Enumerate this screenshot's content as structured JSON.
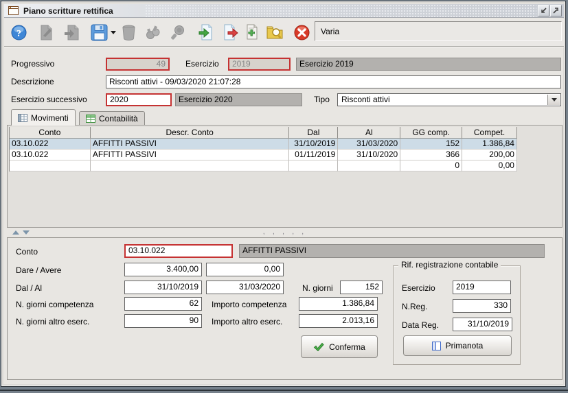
{
  "window": {
    "title": "Piano scritture rettifica"
  },
  "toolbar": {
    "status_text": "Varia",
    "icons": [
      {
        "name": "help",
        "enabled": true
      },
      {
        "name": "modify",
        "enabled": false
      },
      {
        "name": "duplicate",
        "enabled": false
      },
      {
        "name": "save",
        "enabled": true
      },
      {
        "name": "delete",
        "enabled": false
      },
      {
        "name": "keys",
        "enabled": false
      },
      {
        "name": "search",
        "enabled": false
      },
      {
        "name": "import",
        "enabled": true
      },
      {
        "name": "export",
        "enabled": true
      },
      {
        "name": "add-document",
        "enabled": true
      },
      {
        "name": "browse-archive",
        "enabled": true
      },
      {
        "name": "close",
        "enabled": true
      }
    ]
  },
  "form": {
    "progressivo": {
      "label": "Progressivo",
      "value": "49"
    },
    "esercizio": {
      "label": "Esercizio",
      "value": "2019",
      "display": "Esercizio 2019"
    },
    "descrizione": {
      "label": "Descrizione",
      "value": "Risconti attivi - 09/03/2020 21:07:28"
    },
    "esercizio_successivo": {
      "label": "Esercizio successivo",
      "value": "2020",
      "display": "Esercizio 2020"
    },
    "tipo": {
      "label": "Tipo",
      "value": "Risconti attivi"
    }
  },
  "tabs": {
    "movimenti": "Movimenti",
    "contabilita": "Contabilità"
  },
  "table": {
    "columns": [
      "Conto",
      "Descr. Conto",
      "Dal",
      "Al",
      "GG comp.",
      "Compet."
    ],
    "rows": [
      [
        "03.10.022",
        "AFFITTI PASSIVI",
        "31/10/2019",
        "31/03/2020",
        "152",
        "1.386,84"
      ],
      [
        "03.10.022",
        "AFFITTI PASSIVI",
        "01/11/2019",
        "31/10/2020",
        "366",
        "200,00"
      ],
      [
        "",
        "",
        "",
        "",
        "0",
        "0,00"
      ]
    ],
    "selected_row_index": 0
  },
  "detail": {
    "conto": {
      "label": "Conto",
      "value": "03.10.022",
      "descr": "AFFITTI PASSIVI"
    },
    "dare_avere": {
      "label": "Dare / Avere",
      "dare": "3.400,00",
      "avere": "0,00"
    },
    "dal_al": {
      "label": "Dal / Al",
      "dal": "31/10/2019",
      "al": "31/03/2020"
    },
    "n_giorni": {
      "label": "N. giorni",
      "value": "152"
    },
    "giorni_competenza": {
      "label": "N. giorni competenza",
      "value": "62"
    },
    "importo_competenza": {
      "label": "Importo competenza",
      "value": "1.386,84"
    },
    "giorni_altro": {
      "label": "N. giorni altro eserc.",
      "value": "90"
    },
    "importo_altro": {
      "label": "Importo altro eserc.",
      "value": "2.013,16"
    },
    "conferma_label": "Conferma"
  },
  "rif": {
    "title": "Rif. registrazione contabile",
    "esercizio": {
      "label": "Esercizio",
      "value": "2019"
    },
    "nreg": {
      "label": "N.Reg.",
      "value": "330"
    },
    "data_reg": {
      "label": "Data Reg.",
      "value": "31/10/2019"
    },
    "primanota_label": "Primanota"
  },
  "colors": {
    "required_field_border": "#c53232",
    "selection_row": "#cddce7",
    "display_field_bg": "#b3b1ae",
    "close_red": "#d83a28",
    "accent_blue": "#3e86d6",
    "panel_bg": "#e8e6e2"
  }
}
